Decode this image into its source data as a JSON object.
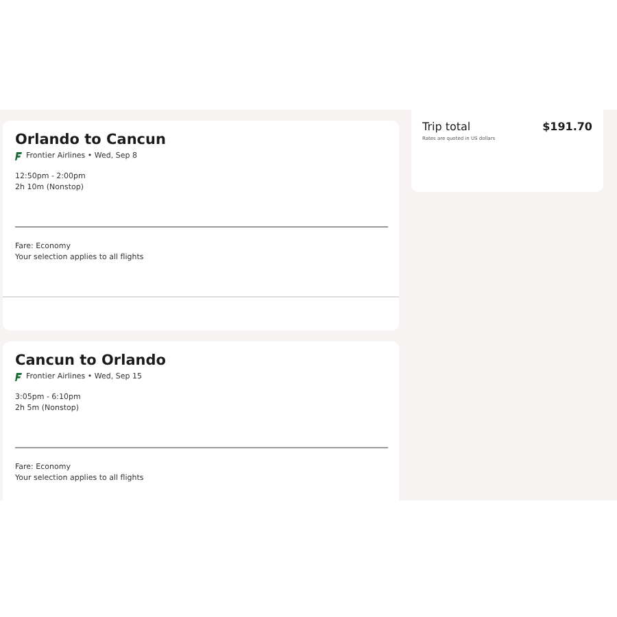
{
  "flights": [
    {
      "route": "Orlando to Cancun",
      "airline": "Frontier Airlines • Wed, Sep 8",
      "times": "12:50pm - 2:00pm",
      "duration": "2h 10m (Nonstop)",
      "fare": "Fare: Economy",
      "note": "Your selection applies to all flights"
    },
    {
      "route": "Cancun to Orlando",
      "airline": "Frontier Airlines • Wed, Sep 15",
      "times": "3:05pm - 6:10pm",
      "duration": "2h 5m (Nonstop)",
      "fare": "Fare: Economy",
      "note": "Your selection applies to all flights"
    }
  ],
  "summary": {
    "title": "Trip total",
    "amount": "$191.70",
    "note": "Rates are quoted in US dollars"
  }
}
